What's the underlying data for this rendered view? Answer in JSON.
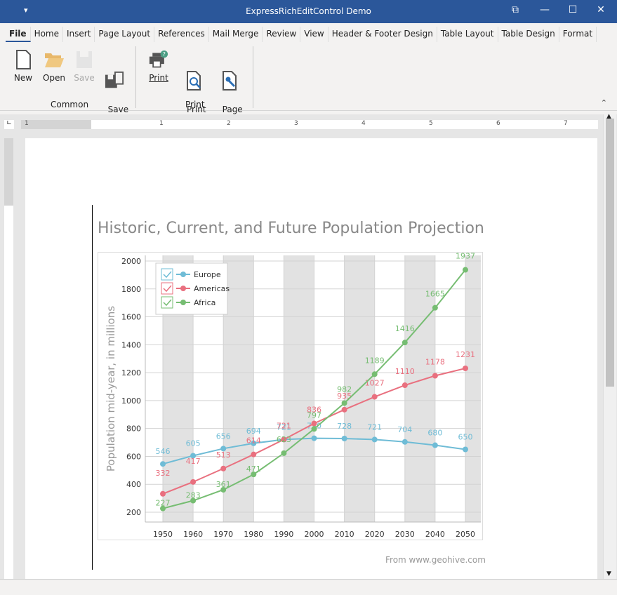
{
  "window": {
    "title": "ExpressRichEditControl Demo",
    "qa_icon": "quick-access-dropdown-icon"
  },
  "tabs": [
    {
      "label": "File",
      "active": true
    },
    {
      "label": "Home"
    },
    {
      "label": "Insert"
    },
    {
      "label": "Page Layout"
    },
    {
      "label": "References"
    },
    {
      "label": "Mail Merge"
    },
    {
      "label": "Review"
    },
    {
      "label": "View"
    },
    {
      "label": "Header & Footer Design"
    },
    {
      "label": "Table Layout"
    },
    {
      "label": "Table Design"
    },
    {
      "label": "Format"
    }
  ],
  "ribbon": {
    "common": {
      "label": "Common",
      "buttons": [
        {
          "label": "New",
          "icon": "new-document-icon"
        },
        {
          "label": "Open",
          "icon": "open-folder-icon"
        },
        {
          "label": "Save",
          "icon": "save-icon",
          "disabled": true
        },
        {
          "label": "Save\nAs",
          "icon": "save-as-icon"
        }
      ]
    },
    "print": {
      "label": "Print",
      "buttons": [
        {
          "label": "Print",
          "icon": "print-icon"
        },
        {
          "label": "Print\nPreview",
          "icon": "print-preview-icon"
        },
        {
          "label": "Page\nSetup",
          "icon": "page-setup-icon"
        }
      ]
    }
  },
  "ruler": {
    "labels": [
      "1",
      "1",
      "2",
      "3",
      "4",
      "5",
      "6",
      "7"
    ]
  },
  "document": {
    "source_text": "From www.geohive.com"
  },
  "chart_data": {
    "type": "line",
    "title": "Historic, Current, and Future Population Projection",
    "ylabel": "Population mid-year, in millions",
    "xlabel": "",
    "x": [
      1950,
      1960,
      1970,
      1980,
      1990,
      2000,
      2010,
      2020,
      2030,
      2040,
      2050
    ],
    "ylim": [
      200,
      2000
    ],
    "yticks": [
      200,
      400,
      600,
      800,
      1000,
      1200,
      1400,
      1600,
      1800,
      2000
    ],
    "grid": true,
    "legend": "top-left",
    "series": [
      {
        "name": "Europe",
        "color": "#6fbcd6",
        "values": [
          546,
          605,
          656,
          694,
          721,
          730,
          728,
          721,
          704,
          680,
          650
        ]
      },
      {
        "name": "Americas",
        "color": "#e9707f",
        "values": [
          332,
          417,
          513,
          614,
          721,
          836,
          935,
          1027,
          1110,
          1178,
          1231
        ]
      },
      {
        "name": "Africa",
        "color": "#76bd72",
        "values": [
          227,
          283,
          361,
          471,
          623,
          797,
          982,
          1189,
          1416,
          1665,
          1937
        ]
      }
    ],
    "colors": {
      "band": "#e2e2e2",
      "grid": "#d3d3d3"
    }
  }
}
